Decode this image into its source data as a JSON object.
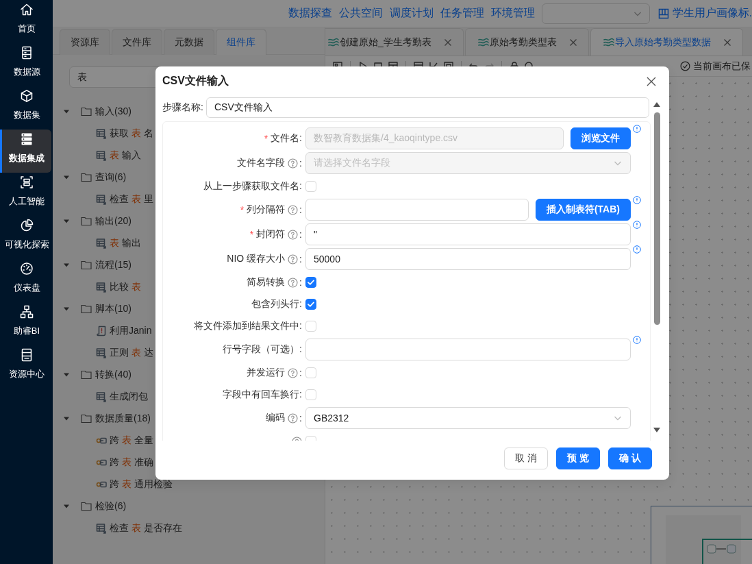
{
  "nav": {
    "items": [
      {
        "label": "首页",
        "selected": false
      },
      {
        "label": "数据源",
        "selected": false
      },
      {
        "label": "数据集",
        "selected": false
      },
      {
        "label": "数据集成",
        "selected": true
      },
      {
        "label": "人工智能",
        "selected": false
      },
      {
        "label": "可视化探索",
        "selected": false
      },
      {
        "label": "仪表盘",
        "selected": false
      },
      {
        "label": "助睿BI",
        "selected": false
      },
      {
        "label": "资源中心",
        "selected": false
      }
    ]
  },
  "top_bar": {
    "links": [
      "数据探查",
      "公共空间",
      "调度计划",
      "任务管理",
      "环境管理"
    ],
    "project": "学生用户画像标."
  },
  "left_panel": {
    "tabs": [
      {
        "label": "资源库",
        "selected": false
      },
      {
        "label": "文件库",
        "selected": false
      },
      {
        "label": "元数据",
        "selected": false
      },
      {
        "label": "组件库",
        "selected": true
      }
    ],
    "search": {
      "value": "表"
    },
    "tree": [
      {
        "label": "输入(30)",
        "expanded": true,
        "children": [
          {
            "segments": [
              {
                "text": "获取 ",
                "highlight": false
              },
              {
                "text": "表",
                "highlight": true
              },
              {
                "text": " 名",
                "highlight": false
              }
            ]
          },
          {
            "segments": [
              {
                "text": "表",
                "highlight": true
              },
              {
                "text": " 输入",
                "highlight": false
              }
            ]
          }
        ]
      },
      {
        "label": "查询(6)",
        "expanded": true,
        "children": [
          {
            "segments": [
              {
                "text": "检查 ",
                "highlight": false
              },
              {
                "text": "表",
                "highlight": true
              },
              {
                "text": " 里",
                "highlight": false
              }
            ]
          }
        ]
      },
      {
        "label": "输出(20)",
        "expanded": true,
        "children": [
          {
            "segments": [
              {
                "text": "表",
                "highlight": true
              },
              {
                "text": " 输出",
                "highlight": false
              }
            ]
          }
        ]
      },
      {
        "label": "流程(15)",
        "expanded": true,
        "children": [
          {
            "segments": [
              {
                "text": "比较 ",
                "highlight": false
              },
              {
                "text": "表",
                "highlight": true
              }
            ]
          }
        ]
      },
      {
        "label": "脚本(10)",
        "expanded": true,
        "children": [
          {
            "segments": [
              {
                "text": "利用Janin",
                "highlight": false
              }
            ]
          },
          {
            "segments": [
              {
                "text": "正则 ",
                "highlight": false
              },
              {
                "text": "表",
                "highlight": true
              },
              {
                "text": " 达",
                "highlight": false
              }
            ]
          }
        ]
      },
      {
        "label": "转换(40)",
        "expanded": true,
        "children": [
          {
            "segments": [
              {
                "text": "生成闭包",
                "highlight": false
              }
            ]
          }
        ]
      },
      {
        "label": "数据质量(18)",
        "expanded": true,
        "children": [
          {
            "segments": [
              {
                "text": "跨 ",
                "highlight": false
              },
              {
                "text": "表",
                "highlight": true
              },
              {
                "text": " 全量",
                "highlight": false
              }
            ]
          },
          {
            "segments": [
              {
                "text": "跨 ",
                "highlight": false
              },
              {
                "text": "表",
                "highlight": true
              },
              {
                "text": " 准确",
                "highlight": false
              }
            ]
          },
          {
            "segments": [
              {
                "text": "跨 ",
                "highlight": false
              },
              {
                "text": "表",
                "highlight": true
              },
              {
                "text": " 通用检验",
                "highlight": false
              }
            ]
          }
        ]
      },
      {
        "label": "检验(6)",
        "expanded": true,
        "children": [
          {
            "segments": [
              {
                "text": "检查 ",
                "highlight": false
              },
              {
                "text": "表",
                "highlight": true
              },
              {
                "text": " 是否存在",
                "highlight": false
              }
            ]
          }
        ]
      }
    ]
  },
  "workspace": {
    "tabs": [
      {
        "label": "创建原始_学生考勤表",
        "selected": false
      },
      {
        "label": "原始考勤类型表",
        "selected": false
      },
      {
        "label": "导入原始考勤类型数据",
        "selected": true
      }
    ],
    "save_status": "当前画布已保"
  },
  "dialog": {
    "title": "CSV文件输入",
    "step": {
      "label": "步骤名称:",
      "value": "CSV文件输入"
    },
    "fields": [
      {
        "kind": "input",
        "marker": "*",
        "label": "文件名:",
        "help": false,
        "value": "数智教育数据集/4_kaoqintype.csv",
        "disabled": true,
        "button": "浏览文件",
        "info": true
      },
      {
        "kind": "select",
        "label": "文件名字段",
        "help": true,
        "colon": ":",
        "placeholder": "请选择文件名字段",
        "disabled": true,
        "info": false
      },
      {
        "kind": "checkbox",
        "label": "从上一步骤获取文件名:",
        "help": false,
        "checked": false,
        "info": false
      },
      {
        "kind": "input",
        "marker": "*",
        "label": "列分隔符",
        "help": true,
        "colon": ":",
        "disabled": false,
        "button": "插入制表符(TAB)",
        "info": true
      },
      {
        "kind": "input",
        "marker": "*",
        "label": "封闭符",
        "help": true,
        "colon": ":",
        "value": "\"",
        "disabled": false,
        "info": true
      },
      {
        "kind": "input",
        "label": "NIO 缓存大小",
        "help": true,
        "colon": ":",
        "value": "50000",
        "disabled": false,
        "info": true
      },
      {
        "kind": "checkbox",
        "label": "简易转换",
        "help": true,
        "colon": ":",
        "checked": true,
        "info": false
      },
      {
        "kind": "checkbox",
        "label": "包含列头行:",
        "help": false,
        "checked": true,
        "info": false
      },
      {
        "kind": "checkbox",
        "label": "将文件添加到结果文件中:",
        "help": false,
        "checked": false,
        "info": false
      },
      {
        "kind": "input",
        "label": "行号字段（可选）:",
        "help": false,
        "disabled": false,
        "info": true
      },
      {
        "kind": "checkbox",
        "label": "并发运行",
        "help": true,
        "colon": ":",
        "checked": false,
        "info": false
      },
      {
        "kind": "checkbox",
        "label": "字段中有回车换行:",
        "help": false,
        "checked": false,
        "info": false
      },
      {
        "kind": "select",
        "label": "编码",
        "help": true,
        "colon": ":",
        "value": "GB2312",
        "disabled": false,
        "info": false
      },
      {
        "kind": "checkbox",
        "help": true,
        "checked": false,
        "info": false
      }
    ],
    "buttons": [
      {
        "label": "取 消",
        "kind": "default"
      },
      {
        "label": "预 览",
        "kind": "primary"
      },
      {
        "label": "确 认",
        "kind": "primary"
      }
    ]
  }
}
